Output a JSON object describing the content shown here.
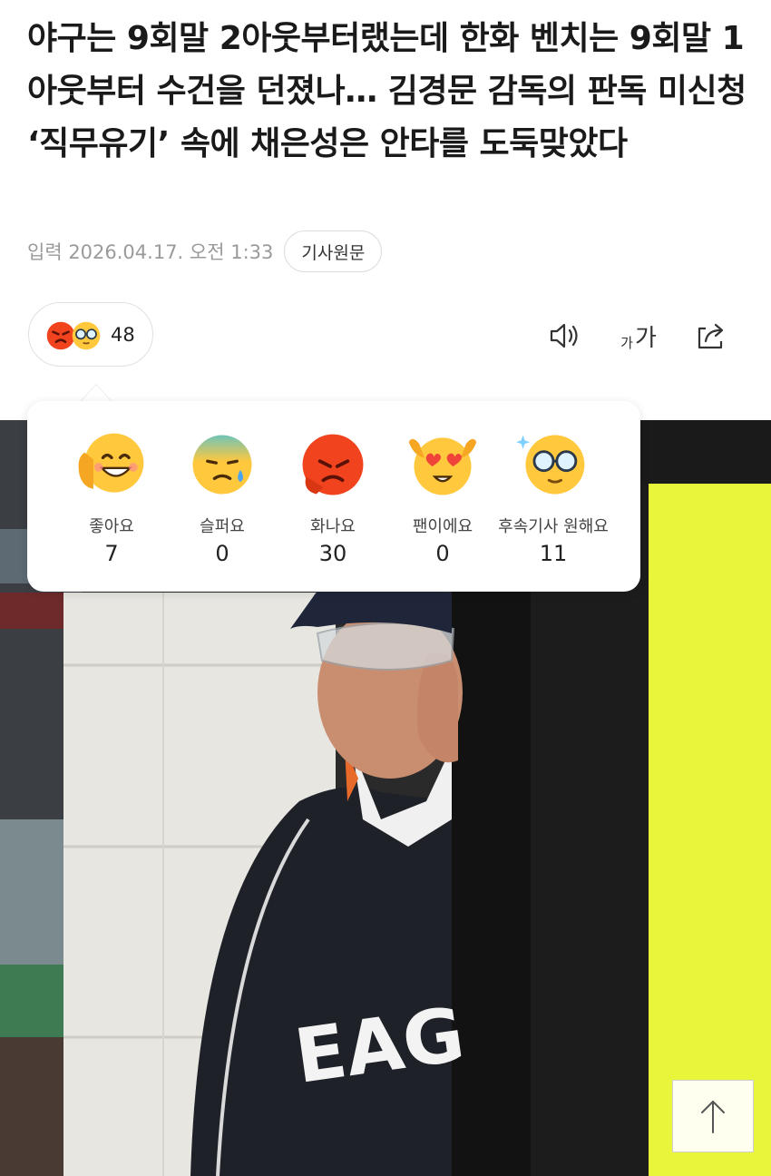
{
  "article": {
    "headline": "야구는 9회말 2아웃부터랬는데 한화 벤치는 9회말 1아웃부터 수건을 던졌나… 김경문 감독의 판독 미신청 ‘직무유기’ 속에 채은성은 안타를 도둑맞았다",
    "date": "입력 2026.04.17. 오전 1:33",
    "original_button": "기사원문"
  },
  "reaction_summary": {
    "count": "48",
    "icons": [
      "angry-face-icon",
      "glasses-face-icon"
    ]
  },
  "toolbar": {
    "font_small": "가",
    "font_large": "가",
    "icons": [
      "speaker-icon",
      "font-size-icon",
      "share-icon"
    ]
  },
  "reactions": [
    {
      "label": "좋아요",
      "count": "7",
      "icon": "smile-face-icon",
      "color": "#FFC83D"
    },
    {
      "label": "슬퍼요",
      "count": "0",
      "icon": "sad-face-icon",
      "color": "#FFC83D"
    },
    {
      "label": "화나요",
      "count": "30",
      "icon": "angry-face-icon",
      "color": "#F0431E"
    },
    {
      "label": "팬이에요",
      "count": "0",
      "icon": "heart-eyes-face-icon",
      "color": "#FFC83D"
    },
    {
      "label": "후속기사 원해요",
      "count": "11",
      "icon": "glasses-face-icon",
      "color": "#FFC83D"
    }
  ],
  "photo": {
    "jersey_text": "EAG"
  },
  "colors": {
    "accent_yellow": "#FFC83D",
    "angry_red": "#F0431E",
    "board_yellow": "#E9F53A"
  }
}
